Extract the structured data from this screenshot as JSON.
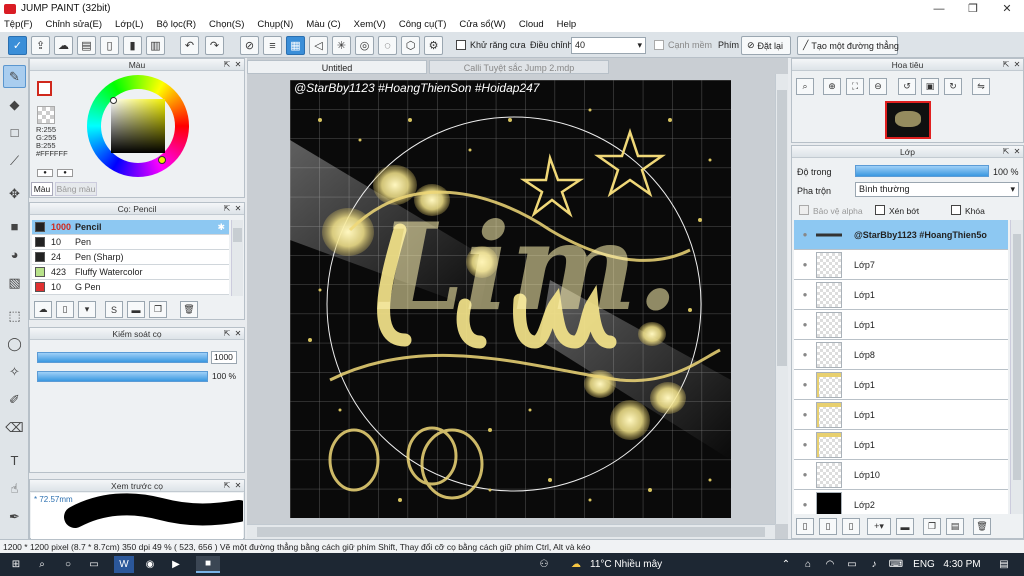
{
  "window": {
    "title": "JUMP PAINT (32bit)",
    "controls": {
      "minimize": "—",
      "restore": "❐",
      "close": "✕"
    }
  },
  "menu": [
    "Tệp(F)",
    "Chỉnh sửa(E)",
    "Lớp(L)",
    "Bộ lọc(R)",
    "Chọn(S)",
    "Chụp(N)",
    "Màu (C)",
    "Xem(V)",
    "Công cụ(T)",
    "Cửa sổ(W)",
    "Cloud",
    "Help"
  ],
  "toolbar": {
    "antialias_label": "Khử răng cưa",
    "adjust_label": "Điều chỉnh",
    "adjust_value": "40",
    "smooth_label": "Cạnh mềm",
    "key_label": "Phím",
    "reset_label": "Đặt lại",
    "straight_line_label": "Tạo một đường thẳng"
  },
  "color_panel": {
    "title": "Màu",
    "rgb": [
      "R:255",
      "G:255",
      "B:255"
    ],
    "hex": "#FFFFFF",
    "tabs": [
      "Màu",
      "Bảng màu"
    ],
    "main_color": "#ffffff",
    "sub_color": "#d0281c"
  },
  "brush_panel": {
    "title": "Cọ: Pencil",
    "brushes": [
      {
        "size": "1000",
        "name": "Pencil",
        "color": "#222222",
        "selected": true
      },
      {
        "size": "10",
        "name": "Pen",
        "color": "#222222"
      },
      {
        "size": "24",
        "name": "Pen (Sharp)",
        "color": "#222222"
      },
      {
        "size": "423",
        "name": "Fluffy Watercolor",
        "color": "#b8e28a"
      },
      {
        "size": "10",
        "name": "G Pen",
        "color": "#e03030"
      }
    ]
  },
  "brush_control": {
    "title": "Kiểm soát cọ",
    "size_value": "1000",
    "opacity_value": "100 %"
  },
  "brush_preview": {
    "title": "Xem trước cọ",
    "size_label": "* 72.57mm"
  },
  "document": {
    "tabs": [
      "Untitled",
      "Calli Tuyệt sắc Jump 2.mdp"
    ],
    "watermark": "@StarBby1123 #HoangThienSon #Hoidap247",
    "artwork_text": "Lim."
  },
  "navigator": {
    "title": "Hoa tiêu"
  },
  "layer_panel": {
    "title": "Lớp",
    "opacity_label": "Độ trong",
    "opacity_value": "100 %",
    "opacity_fraction": 1.0,
    "blend_label": "Pha trộn",
    "blend_value": "Bình thường",
    "protect_alpha": "Bảo vệ alpha",
    "clip": "Xén bớt",
    "lock": "Khóa",
    "layers": [
      {
        "name": "@StarBby1123 #HoangThien5o",
        "selected": true,
        "thumb": "line"
      },
      {
        "name": "Lớp7",
        "thumb": "empty"
      },
      {
        "name": "Lớp1",
        "thumb": "empty"
      },
      {
        "name": "Lớp1",
        "thumb": "empty"
      },
      {
        "name": "Lớp8",
        "thumb": "empty"
      },
      {
        "name": "Lớp1",
        "thumb": "art"
      },
      {
        "name": "Lớp1",
        "thumb": "art"
      },
      {
        "name": "Lớp1",
        "thumb": "art"
      },
      {
        "name": "Lớp10",
        "thumb": "empty"
      },
      {
        "name": "Lớp2",
        "thumb": "black"
      }
    ]
  },
  "status": {
    "text": "1200 * 1200 pixel  (8.7 * 8.7cm)  350 dpi   49 %   ( 523, 656 )   Vẽ một đường thẳng bằng cách giữ phím Shift, Thay đổi cỡ cọ bằng cách giữ phím Ctrl, Alt và kéo"
  },
  "taskbar": {
    "weather": "11°C  Nhiều mây",
    "lang": "ENG",
    "time": "4:30 PM"
  }
}
